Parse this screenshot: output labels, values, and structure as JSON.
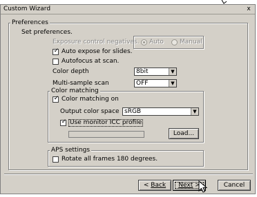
{
  "window": {
    "title": "Custom Wizard",
    "close_label": "x"
  },
  "preferences": {
    "legend": "Preferences",
    "intro": "Set preferences.",
    "exposure_label": "Exposure control negatives.",
    "radio_auto": "Auto",
    "radio_manual": "Manual",
    "auto_expose_label": "Auto expose for slides.",
    "auto_expose_checked": "✓",
    "autofocus_label": "Autofocus at scan.",
    "color_depth_label": "Color depth",
    "color_depth_value": "8bit",
    "multi_sample_label": "Multi-sample scan",
    "multi_sample_value": "OFF"
  },
  "color_matching": {
    "legend": "Color matching",
    "color_matching_on_label": "Color matching on",
    "color_matching_on_checked": "✓",
    "output_space_label": "Output color space",
    "output_space_value": "sRGB",
    "use_icc_label": "Use monitor ICC profile",
    "use_icc_checked": "✓",
    "load_button": "Load..."
  },
  "aps": {
    "legend": "APS settings",
    "rotate_label": "Rotate all frames 180 degrees."
  },
  "footer": {
    "back_prefix": "< ",
    "back_label": "Back",
    "next_label": "Next",
    "next_suffix": " >",
    "cancel_label": "Cancel"
  },
  "icons": {
    "dropdown": "▼"
  }
}
